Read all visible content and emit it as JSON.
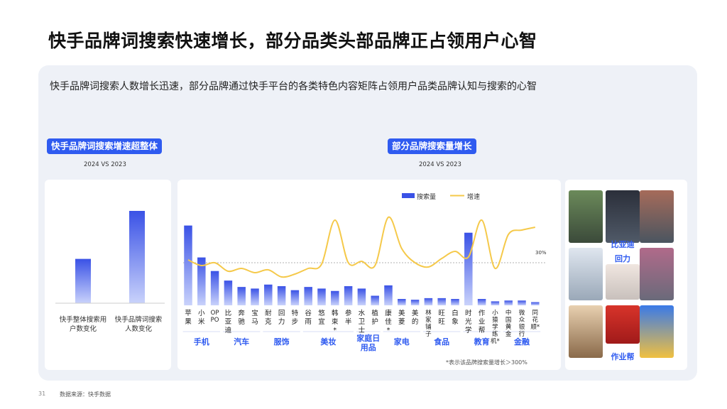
{
  "title": "快手品牌词搜索快速增长，部分品类头部品牌正占领用户心智",
  "subtitle": "快手品牌词搜索人数增长迅速，部分品牌通过快手平台的各类特色内容矩阵占领用户品类品牌认知与搜索的心智",
  "left_panel": {
    "pill": "快手品牌词搜索增速超整体",
    "vs": "2024 VS 2023"
  },
  "right_panel": {
    "pill": "部分品牌搜索量增长",
    "vs": "2024 VS 2023"
  },
  "footnote": "*表示该品牌搜索量增长＞300%",
  "source": "数据来源：快手数据",
  "page_number": "31",
  "image_labels": [
    "比亚迪",
    "回力",
    "作业帮"
  ],
  "colors": {
    "bar": "#3a52e6",
    "line": "#f5c94a",
    "accent": "#2f5bf0"
  },
  "chart_data": [
    {
      "type": "bar",
      "categories": [
        "快手整体搜索用户数变化",
        "快手品牌词搜索人数变化"
      ],
      "values": [
        0.48,
        1.0
      ],
      "ylim": [
        0,
        1.2
      ]
    },
    {
      "type": "bar+line",
      "legend": [
        "搜索量",
        "增速"
      ],
      "legend_position": "top-right",
      "reference_label": "30%",
      "categories": [
        "苹果",
        "小米",
        "OPPO",
        "比亚迪",
        "奔驰",
        "宝马",
        "耐克",
        "回力",
        "特步",
        "谷雨",
        "悠宜",
        "韩束*",
        "参半",
        "水卫士",
        "植护",
        "康佳*",
        "美菱",
        "美的",
        "林家铺子",
        "旺旺",
        "白象",
        "时光学",
        "作业帮",
        "小猿学练机*",
        "中国黄金",
        "微众银行",
        "同花顺*"
      ],
      "groups": [
        {
          "label": "手机",
          "range": [
            0,
            2
          ]
        },
        {
          "label": "汽车",
          "range": [
            3,
            5
          ]
        },
        {
          "label": "服饰",
          "range": [
            6,
            8
          ]
        },
        {
          "label": "美妆",
          "range": [
            9,
            12
          ]
        },
        {
          "label": "家庭日用品",
          "range": [
            13,
            14
          ]
        },
        {
          "label": "家电",
          "range": [
            15,
            17
          ]
        },
        {
          "label": "食品",
          "range": [
            18,
            20
          ]
        },
        {
          "label": "教育",
          "range": [
            21,
            23
          ]
        },
        {
          "label": "金融",
          "range": [
            24,
            26
          ]
        }
      ],
      "series": [
        {
          "name": "搜索量",
          "kind": "bar",
          "values": [
            1.0,
            0.6,
            0.43,
            0.31,
            0.23,
            0.21,
            0.26,
            0.24,
            0.19,
            0.23,
            0.21,
            0.18,
            0.24,
            0.21,
            0.12,
            0.25,
            0.08,
            0.07,
            0.09,
            0.09,
            0.08,
            0.91,
            0.08,
            0.05,
            0.06,
            0.06,
            0.04
          ]
        },
        {
          "name": "增速",
          "kind": "line",
          "values": [
            0.32,
            0.28,
            0.3,
            0.24,
            0.26,
            0.23,
            0.25,
            0.2,
            0.22,
            0.26,
            0.29,
            0.6,
            0.3,
            0.31,
            0.28,
            0.62,
            0.4,
            0.3,
            0.27,
            0.33,
            0.38,
            0.34,
            0.6,
            0.26,
            0.5,
            0.53,
            0.55
          ]
        }
      ],
      "ylim_bar": [
        0,
        1.05
      ],
      "ylim_line": [
        0,
        0.8
      ],
      "reference_line": 0.3
    }
  ]
}
